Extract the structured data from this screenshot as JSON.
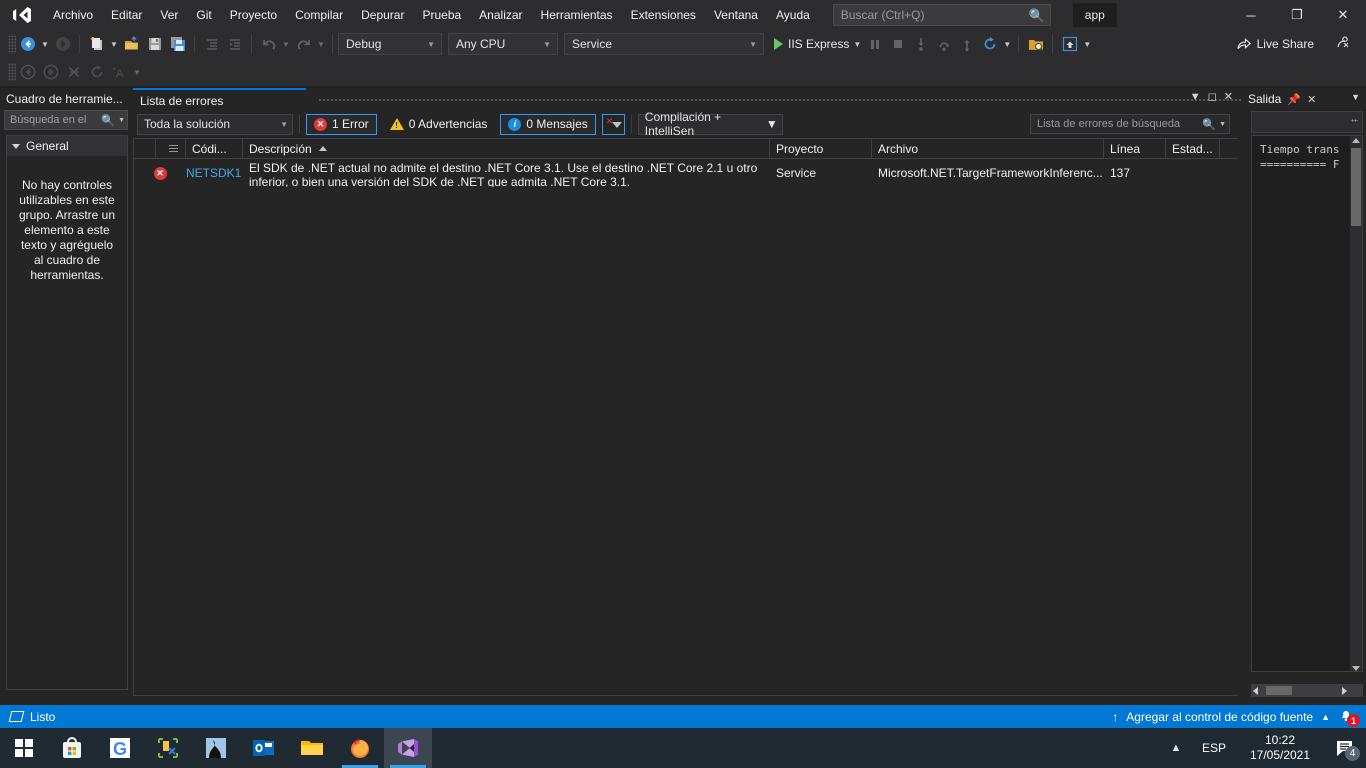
{
  "titlebar": {
    "logo_icon": "visual-studio-icon",
    "menu": [
      {
        "label": "Archivo"
      },
      {
        "label": "Editar"
      },
      {
        "label": "Ver"
      },
      {
        "label": "Git"
      },
      {
        "label": "Proyecto"
      },
      {
        "label": "Compilar"
      },
      {
        "label": "Depurar"
      },
      {
        "label": "Prueba"
      },
      {
        "label": "Analizar"
      },
      {
        "label": "Herramientas"
      },
      {
        "label": "Extensiones"
      },
      {
        "label": "Ventana"
      },
      {
        "label": "Ayuda"
      }
    ],
    "search_placeholder": "Buscar (Ctrl+Q)",
    "search_value": "",
    "search_icon": "search-icon",
    "project_name": "app",
    "window_minimize": "─",
    "window_restore": "❐",
    "window_close": "✕"
  },
  "toolbar": {
    "nav_back_icon": "navigate-back-icon",
    "nav_forward_icon": "navigate-forward-icon",
    "new_project_icon": "new-project-icon",
    "open_file_icon": "open-file-icon",
    "save_icon": "save-icon",
    "save_all_icon": "save-all-icon",
    "outdent_icon": "decrease-indent-icon",
    "indent_icon": "increase-indent-icon",
    "undo_icon": "undo-icon",
    "redo_icon": "redo-icon",
    "configuration": "Debug",
    "platform": "Any CPU",
    "startup_project": "Service",
    "run_label": "IIS Express",
    "run_icon": "play-icon",
    "pause_icon": "pause-icon",
    "stop_icon": "stop-icon",
    "step_into_icon": "step-into-icon",
    "step_over_icon": "step-over-icon",
    "step_out_icon": "step-out-icon",
    "restart_icon": "restart-icon",
    "browser_icon": "browse-with-icon",
    "preview_icon": "preview-selected-items-icon",
    "overflow_icon": "toolbar-overflow-icon",
    "live_share_label": "Live Share",
    "live_share_icon": "live-share-icon",
    "feedback_icon": "send-feedback-icon"
  },
  "toolbar2": {
    "back_icon": "back-icon",
    "forward_icon": "forward-icon",
    "stop-x_icon": "cancel-icon",
    "refresh_icon": "refresh-icon",
    "font_icon": "font-size-icon",
    "overflow_icon": "toolbar-overflow-icon"
  },
  "toolbox": {
    "title": "Cuadro de herramie...",
    "search_placeholder": "Búsqueda en el",
    "search_icon": "search-icon",
    "dropdown_icon": "chevron-down-icon",
    "group_label": "General",
    "group_expander_icon": "triangle-down-icon",
    "empty_message": "No hay controles utilizables en este grupo. Arrastre un elemento a este texto y agréguelo al cuadro de herramientas."
  },
  "errorlist": {
    "tab_label": "Lista de errores",
    "window_dropdown_icon": "chevron-down-icon",
    "window_maximize_icon": "maximize-icon",
    "window_close_icon": "close-icon",
    "scope_filter": "Toda la solución",
    "counts": {
      "errors": "1 Error",
      "warnings": "0 Advertencias",
      "messages": "0 Mensajes"
    },
    "error_icon": "error-icon",
    "warning_icon": "warning-icon",
    "info_icon": "information-icon",
    "filter_icon": "filter-errors-icon",
    "source_filter": "Compilación + IntelliSen",
    "search_placeholder": "Lista de errores de búsqueda",
    "search_icon": "search-icon",
    "search_dropdown_icon": "chevron-down-icon",
    "columns": [
      {
        "key": "severity",
        "label": ""
      },
      {
        "key": "code",
        "label": "Códi..."
      },
      {
        "key": "description",
        "label": "Descripción",
        "sorted": "asc"
      },
      {
        "key": "project",
        "label": "Proyecto"
      },
      {
        "key": "file",
        "label": "Archivo"
      },
      {
        "key": "line",
        "label": "Línea"
      },
      {
        "key": "state",
        "label": "Estad..."
      }
    ],
    "rows": [
      {
        "severity_icon": "error-icon",
        "code": "NETSDK1",
        "description": "El SDK de .NET actual no admite el destino .NET Core 3.1. Use el destino .NET Core 2.1 u otro inferior, o bien una versión del SDK de .NET que admita .NET Core 3.1.",
        "project": "Service",
        "file": "Microsoft.NET.TargetFrameworkInferenc...",
        "line": "137",
        "state": ""
      }
    ]
  },
  "output": {
    "tab_label": "Salida",
    "pin_icon": "pin-icon",
    "close_icon": "close-icon",
    "chevron_icon": "chevron-down-icon",
    "text": "Tiempo trans\n========== F"
  },
  "statusbar": {
    "status_icon": "ready-icon",
    "status_text": "Listo",
    "source_control_label": "Agregar al control de código fuente",
    "source_control_icon": "arrow-up-icon",
    "source_control_chevron": "chevron-up-icon",
    "notifications_icon": "notifications-bell-icon",
    "notifications_count": "1"
  },
  "taskbar": {
    "apps": [
      {
        "name": "start-button",
        "icon": "windows-logo-icon"
      },
      {
        "name": "microsoft-store",
        "icon": "store-icon"
      },
      {
        "name": "google-chrome",
        "icon": "google-icon"
      },
      {
        "name": "snip-and-sketch",
        "icon": "snip-sketch-icon"
      },
      {
        "name": "mobile-app",
        "icon": "dark-figure-icon"
      },
      {
        "name": "outlook",
        "icon": "outlook-icon"
      },
      {
        "name": "file-explorer",
        "icon": "folder-icon"
      },
      {
        "name": "firefox",
        "icon": "firefox-icon"
      },
      {
        "name": "visual-studio",
        "icon": "visual-studio-icon"
      }
    ],
    "tray_chevron_icon": "chevron-up-icon",
    "language": "ESP",
    "time": "10:22",
    "date": "17/05/2021",
    "action_center_icon": "action-center-icon",
    "action_center_count": "4"
  },
  "colors": {
    "accent": "#0078d4",
    "error": "#e03a3a",
    "warning": "#f0c419",
    "info": "#1a8fe0",
    "link": "#4aa5e8",
    "chrome": "#2d2d30"
  }
}
